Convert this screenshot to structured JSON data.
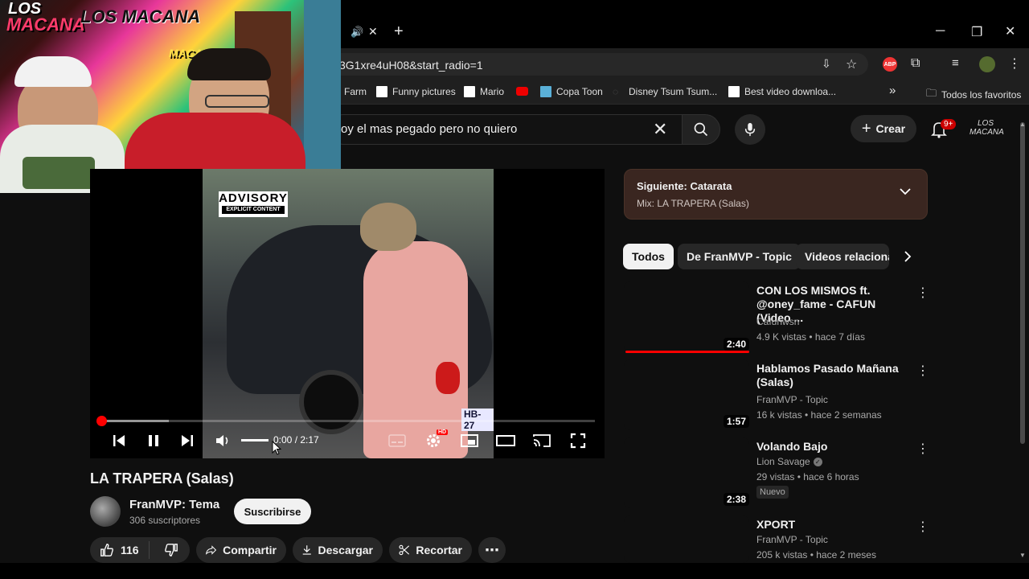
{
  "browser": {
    "url": "3G1xre4uH08&start_radio=1",
    "new_tab": "+",
    "close_tab": "✕",
    "bookmarks": [
      "Farm",
      "Funny pictures",
      "Mario",
      "Copa Toon",
      "Disney Tsum Tsum...",
      "Best video downloa..."
    ],
    "bookmarks_more": "»",
    "all_bookmarks": "Todos los favoritos"
  },
  "youtube": {
    "search_query": "oy el mas pegado pero no quiero",
    "create_label": "Crear",
    "notif_count": "9+",
    "channel_logo": "LOS MACANA"
  },
  "webcam": {
    "graffiti": [
      "LOS",
      "MACANA",
      "LOS MACANA",
      "MACANA"
    ]
  },
  "player": {
    "advisory_title": "ADVISORY",
    "advisory_sub": "EXPLICIT CONTENT",
    "time_current": "0:00",
    "time_total": "2:17",
    "progress": 0.0,
    "buffered": 0.14,
    "volume": 0.9,
    "hd_badge": "HD",
    "plate": "HB-27"
  },
  "video": {
    "title": "LA TRAPERA (Salas)",
    "channel": "FranMVP: Tema",
    "subscribers": "306 suscriptores",
    "subscribe_label": "Suscribirse",
    "likes": "116",
    "share_label": "Compartir",
    "download_label": "Descargar",
    "clip_label": "Recortar",
    "more_label": "⋯"
  },
  "up_next": {
    "label": "Siguiente: Catarata",
    "mix": "Mix: LA TRAPERA (Salas)"
  },
  "chips": [
    "Todos",
    "De FranMVP - Topic",
    "Videos relacionad"
  ],
  "related": [
    {
      "title": "CON LOS MISMOS ft. @oney_fame  - CAFUN (Video ...",
      "channel": "Cafunwsn",
      "meta": "4.9 K vistas • hace 7 días",
      "duration": "2:40"
    },
    {
      "title": "Hablamos Pasado Mañana (Salas)",
      "channel": "FranMVP - Topic",
      "meta": "16 k vistas • hace 2 semanas",
      "duration": "1:57"
    },
    {
      "title": "Volando Bajo",
      "channel": "Lion Savage",
      "meta": "29 vistas • hace 6 horas",
      "duration": "2:38",
      "badge": "Nuevo"
    },
    {
      "title": "XPORT",
      "channel": "FranMVP - Topic",
      "meta": "205 k vistas • hace 2 meses",
      "duration": ""
    }
  ],
  "colors": {
    "accent": "#ff0000",
    "bg": "#0f0f0f",
    "chip": "#272727"
  }
}
